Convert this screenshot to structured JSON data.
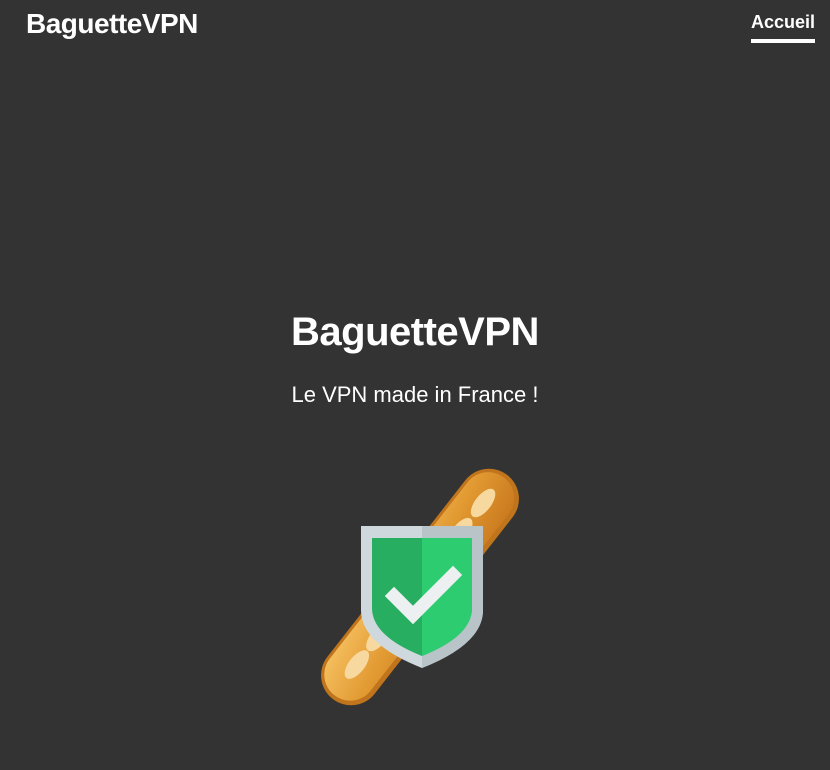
{
  "header": {
    "brand": "BaguetteVPN",
    "nav": [
      {
        "label": "Accueil",
        "active": true
      }
    ]
  },
  "hero": {
    "title": "BaguetteVPN",
    "subtitle": "Le VPN made in France !"
  },
  "logo": {
    "icon": "baguette-shield-check-icon",
    "colors": {
      "bread": "#E7A23A",
      "shield_green": "#2ECC71",
      "shield_border": "#CFD8DC",
      "check": "#ECF0F1"
    }
  },
  "colors": {
    "background": "#333333",
    "text": "#FFFFFF"
  }
}
